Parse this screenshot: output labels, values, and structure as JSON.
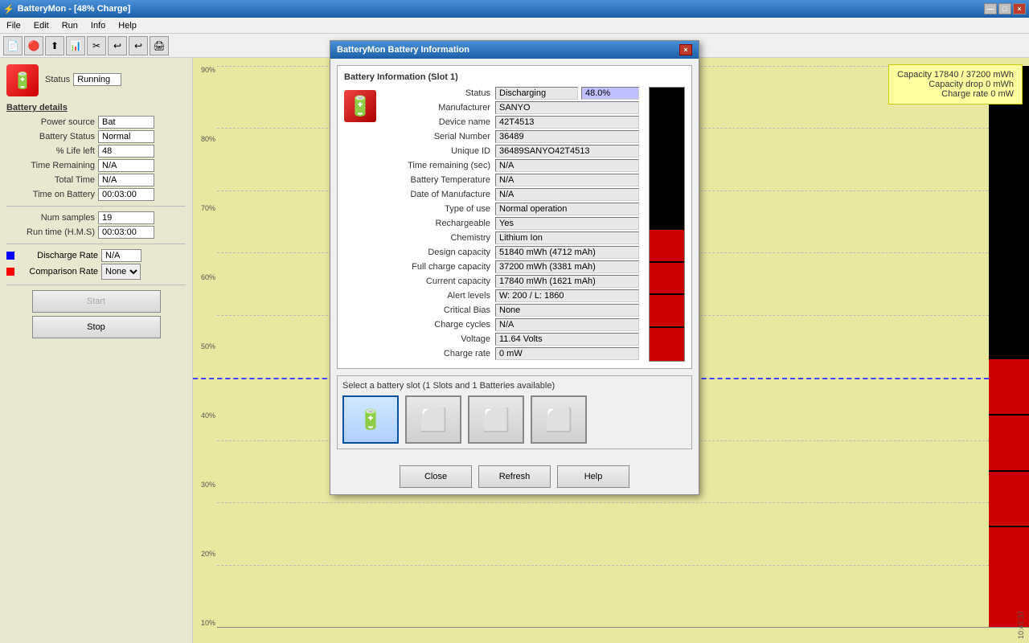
{
  "titleBar": {
    "title": "BatteryMon - [48% Charge]",
    "closeBtn": "×",
    "minimizeBtn": "—",
    "maximizeBtn": "□"
  },
  "menuBar": {
    "items": [
      "File",
      "Edit",
      "Run",
      "Info",
      "Help"
    ]
  },
  "leftPanel": {
    "statusLabel": "Status",
    "statusValue": "Running",
    "sectionTitle": "Battery details",
    "fields": [
      {
        "label": "Power source",
        "value": "Bat"
      },
      {
        "label": "Battery Status",
        "value": "Normal"
      },
      {
        "label": "% Life left",
        "value": "48"
      },
      {
        "label": "Time Remaining",
        "value": "N/A"
      },
      {
        "label": "Total Time",
        "value": "N/A"
      },
      {
        "label": "Time on Battery",
        "value": "00:03:00"
      }
    ],
    "fields2": [
      {
        "label": "Num samples",
        "value": "19"
      },
      {
        "label": "Run time (H.M.S)",
        "value": "00:03:00"
      }
    ],
    "dischargeRate": {
      "label": "Discharge Rate",
      "value": "N/A",
      "color": "#0000ff"
    },
    "comparisonRate": {
      "label": "Comparison Rate",
      "value": "None",
      "color": "#ff0000"
    },
    "startBtn": "Start",
    "stopBtn": "Stop"
  },
  "chartArea": {
    "percentageLabels": [
      "90%",
      "80%",
      "70%",
      "60%",
      "50%",
      "40%",
      "30%",
      "20%",
      "10%"
    ],
    "timeLabel": "10:47:37"
  },
  "infoBox": {
    "line1": "Capacity 17840 / 37200 mWh",
    "line2": "Capacity drop 0 mWh",
    "line3": "Charge rate 0 mW"
  },
  "modal": {
    "title": "BatteryMon Battery Information",
    "groupTitle": "Battery Information (Slot 1)",
    "fields": [
      {
        "label": "Status",
        "value": "Discharging",
        "extra": "48.0%"
      },
      {
        "label": "Manufacturer",
        "value": "SANYO"
      },
      {
        "label": "Device name",
        "value": "42T4513"
      },
      {
        "label": "Serial Number",
        "value": "36489"
      },
      {
        "label": "Unique ID",
        "value": "36489SANYO42T4513"
      },
      {
        "label": "Time remaining (sec)",
        "value": "N/A"
      },
      {
        "label": "Battery Temperature",
        "value": "N/A"
      },
      {
        "label": "Date of Manufacture",
        "value": "N/A"
      },
      {
        "label": "Type of use",
        "value": "Normal operation"
      },
      {
        "label": "Rechargeable",
        "value": "Yes"
      },
      {
        "label": "Chemistry",
        "value": "Lithium Ion"
      },
      {
        "label": "Design capacity",
        "value": "51840 mWh (4712 mAh)"
      },
      {
        "label": "Full charge capacity",
        "value": "37200 mWh (3381 mAh)"
      },
      {
        "label": "Current capacity",
        "value": "17840 mWh (1621 mAh)"
      },
      {
        "label": "Alert levels",
        "value": "W: 200 / L: 1860"
      },
      {
        "label": "Critical Bias",
        "value": "None"
      },
      {
        "label": "Charge cycles",
        "value": "N/A"
      },
      {
        "label": "Voltage",
        "value": "11.64 Volts"
      },
      {
        "label": "Charge rate",
        "value": "0 mW"
      }
    ],
    "chargePercent": 48,
    "slotGroupTitle": "Select a battery slot (1 Slots and 1 Batteries available)",
    "slots": [
      {
        "active": true,
        "icon": "🔋"
      },
      {
        "active": false,
        "icon": "🪫"
      },
      {
        "active": false,
        "icon": "🪫"
      },
      {
        "active": false,
        "icon": "🪫"
      }
    ],
    "buttons": [
      "Close",
      "Refresh",
      "Help"
    ]
  }
}
